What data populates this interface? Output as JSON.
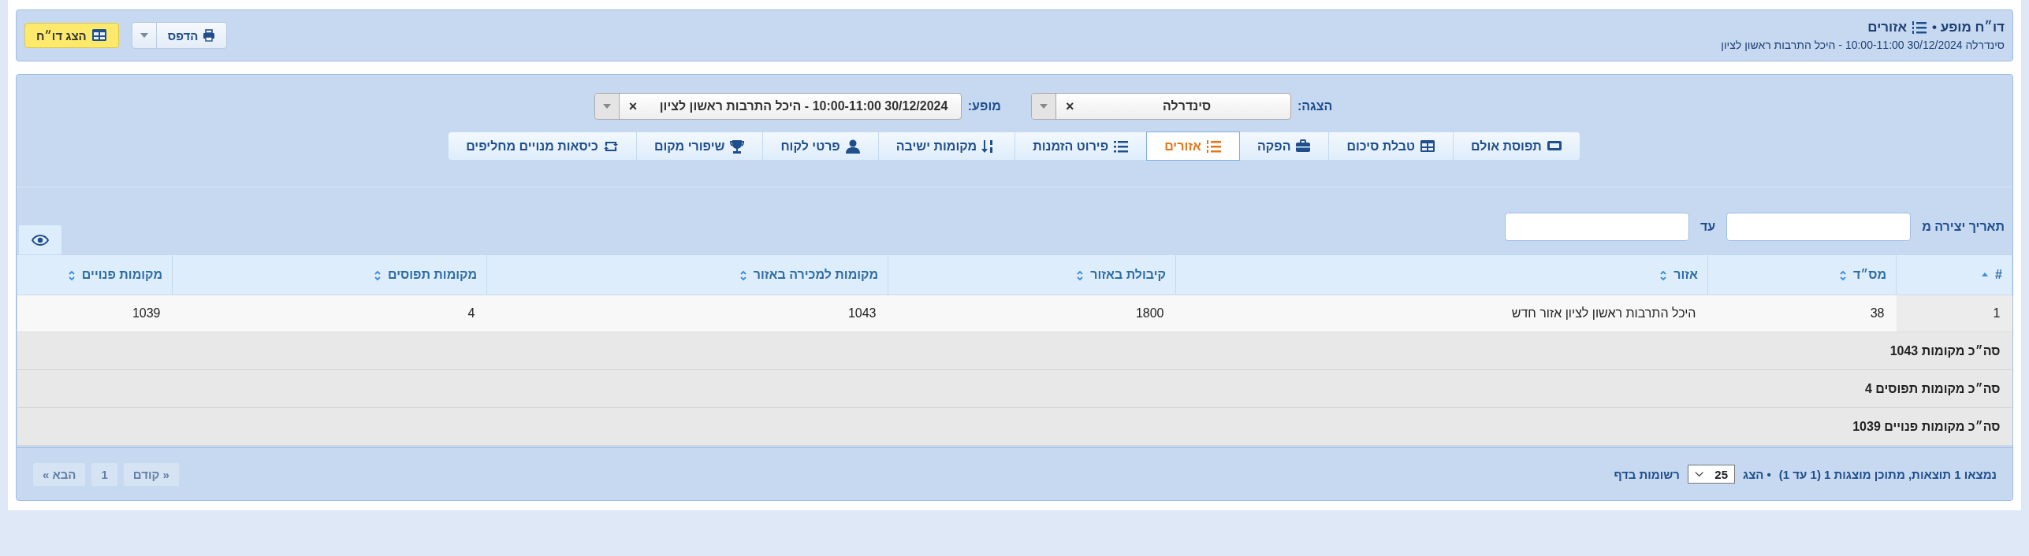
{
  "header": {
    "title_prefix": "דו״ח מופע •",
    "title": "אזורים",
    "subtitle": "סינדרלה 30/12/2024 10:00-11:00 - היכל התרבות ראשון לציון"
  },
  "toolbar": {
    "print_button": "הדפס",
    "show_report_button": "הצג דו״ח"
  },
  "filters": [
    {
      "label": "הצגה:",
      "value": "סינדרלה",
      "clear": "×"
    },
    {
      "label": "מופע:",
      "value": "30/12/2024 10:00-11:00 - היכל התרבות ראשון לציון",
      "clear": "×"
    }
  ],
  "tabs": [
    {
      "label": "תפוסת אולם",
      "kind": "ticket",
      "selected": false
    },
    {
      "label": "טבלת סיכום",
      "kind": "table",
      "selected": false
    },
    {
      "label": "הפקה",
      "kind": "briefcase",
      "selected": false
    },
    {
      "label": "אזורים",
      "kind": "numbered-list",
      "selected": true
    },
    {
      "label": "פירוט הזמנות",
      "kind": "list",
      "selected": false
    },
    {
      "label": "מקומות ישיבה",
      "kind": "sort",
      "selected": false
    },
    {
      "label": "פרטי לקוח",
      "kind": "user",
      "selected": false
    },
    {
      "label": "שיפורי מקום",
      "kind": "trophy",
      "selected": false
    },
    {
      "label": "כיסאות מנויים מחליפים",
      "kind": "swap",
      "selected": false
    }
  ],
  "date_filter": {
    "from_label": "תאריך יצירה מ",
    "to_label": "עד"
  },
  "table": {
    "columns": [
      {
        "label": "#",
        "sorted": true
      },
      {
        "label": "מס״ד",
        "sorted": false
      },
      {
        "label": "אזור",
        "sorted": false
      },
      {
        "label": "קיבולת באזור",
        "sorted": false
      },
      {
        "label": "מקומות למכירה באזור",
        "sorted": false
      },
      {
        "label": "מקומות תפוסים",
        "sorted": false
      },
      {
        "label": "מקומות פנויים",
        "sorted": false
      }
    ],
    "rows": [
      [
        "1",
        "38",
        "היכל התרבות ראשון לציון אזור חדש",
        "1800",
        "1043",
        "4",
        "1039"
      ]
    ],
    "summary": [
      "סה״כ מקומות 1043",
      "סה״כ מקומות תפוסים 4",
      "סה״כ מקומות פנויים 1039"
    ]
  },
  "footer": {
    "results": "נמצאו 1 תוצאות, מתוכן מוצגות 1 (1 עד 1)",
    "show_label": "• הצג",
    "page_size": "25",
    "per_page_label": "רשומות בדף",
    "pagination": [
      {
        "label": "« קודם",
        "disabled": true
      },
      {
        "label": "1",
        "disabled": true
      },
      {
        "label": "הבא »",
        "disabled": true
      }
    ]
  }
}
